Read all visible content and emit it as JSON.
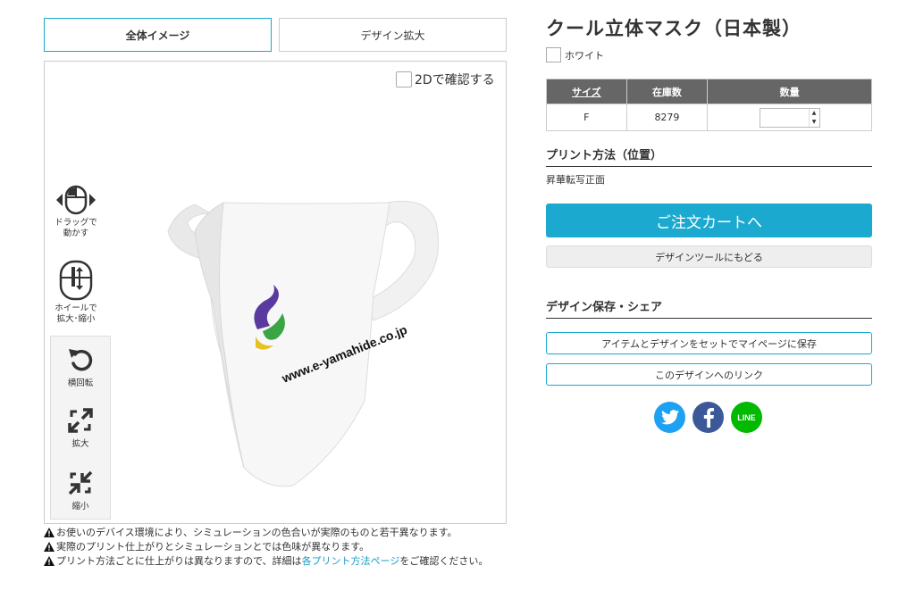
{
  "tabs": {
    "full": "全体イメージ",
    "zoom": "デザイン拡大"
  },
  "viewer": {
    "check2d": "2Dで確認する",
    "hints": {
      "drag": "ドラッグで\n動かす",
      "wheel": "ホイールで\n拡大･縮小"
    },
    "controls": {
      "rotate": "横回転",
      "zoom_in": "拡大",
      "zoom_out": "縮小"
    },
    "mask_print": "www.e-yamahide.co.jp"
  },
  "notes": {
    "n1": "お使いのデバイス環境により、シミュレーションの色合いが実際のものと若干異なります。",
    "n2": "実際のプリント仕上がりとシミュレーションとでは色味が異なります。",
    "n3_before": "プリント方法ごとに仕上がりは異なりますので、詳細は",
    "n3_link": "各プリント方法ページ",
    "n3_after": "をご確認ください。"
  },
  "product": {
    "title": "クール立体マスク（日本製）",
    "color": "ホワイト"
  },
  "stock_table": {
    "headers": [
      "サイズ",
      "在庫数",
      "数量"
    ],
    "rows": [
      {
        "size": "F",
        "stock": "8279",
        "qty": ""
      }
    ]
  },
  "print": {
    "heading": "プリント方法（位置）",
    "value": "昇華転写正面"
  },
  "buttons": {
    "cart": "ご注文カートへ",
    "back": "デザインツールにもどる",
    "save": "アイテムとデザインをセットでマイページに保存",
    "link": "このデザインへのリンク"
  },
  "share": {
    "heading": "デザイン保存・シェア",
    "line_label": "LINE"
  },
  "icons": [
    "mouse-drag-icon",
    "mouse-wheel-icon",
    "rotate-icon",
    "expand-icon",
    "compress-icon",
    "warning-icon",
    "twitter-icon",
    "facebook-icon",
    "line-icon"
  ],
  "colors": {
    "accent": "#1ba9cf",
    "table_header": "#666666",
    "twitter": "#1da1f2",
    "facebook": "#3b5998",
    "line": "#00b900"
  }
}
